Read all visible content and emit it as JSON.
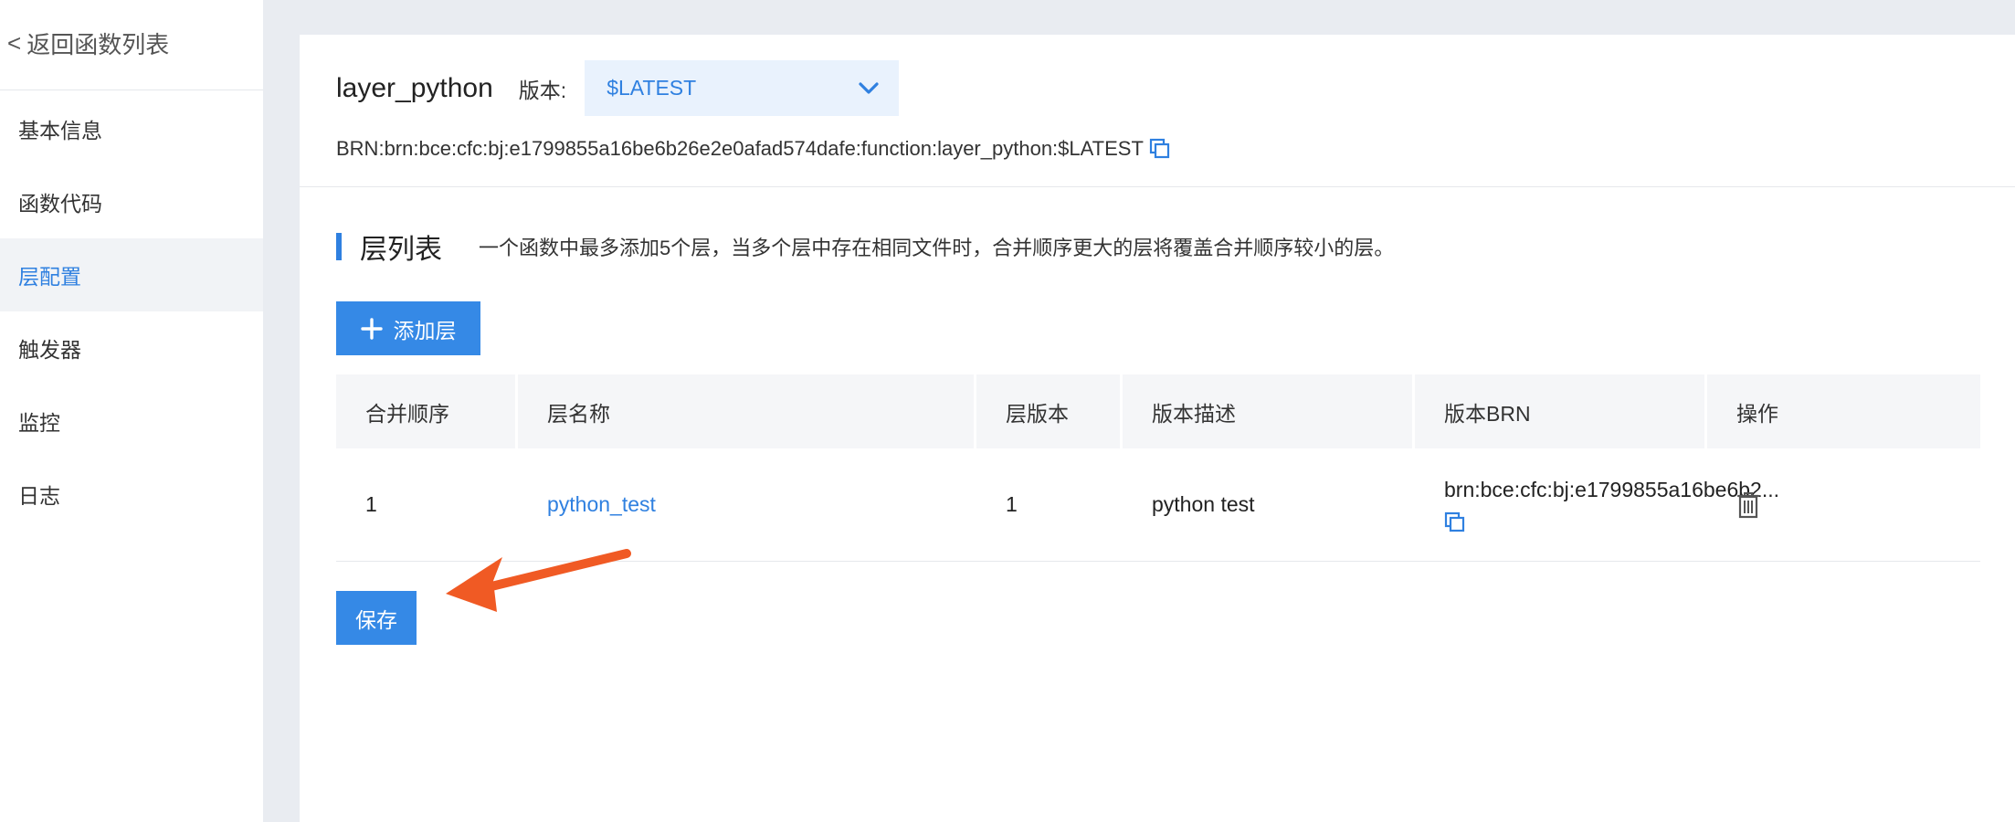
{
  "sidebar": {
    "back_label": "返回函数列表",
    "items": [
      {
        "label": "基本信息"
      },
      {
        "label": "函数代码"
      },
      {
        "label": "层配置"
      },
      {
        "label": "触发器"
      },
      {
        "label": "监控"
      },
      {
        "label": "日志"
      }
    ],
    "active_index": 2
  },
  "header": {
    "function_name": "layer_python",
    "version_label": "版本:",
    "version_value": "$LATEST",
    "brn_label": "BRN:",
    "brn_value": "brn:bce:cfc:bj:e1799855a16be6b26e2e0afad574dafe:function:layer_python:$LATEST"
  },
  "section": {
    "title": "层列表",
    "description": "一个函数中最多添加5个层，当多个层中存在相同文件时，合并顺序更大的层将覆盖合并顺序较小的层。"
  },
  "add_button": {
    "label": "添加层"
  },
  "table": {
    "columns": [
      "合并顺序",
      "层名称",
      "层版本",
      "版本描述",
      "版本BRN",
      "操作"
    ],
    "rows": [
      {
        "order": "1",
        "name": "python_test",
        "version": "1",
        "description": "python test",
        "brn": "brn:bce:cfc:bj:e1799855a16be6b2..."
      }
    ]
  },
  "save_button": {
    "label": "保存"
  },
  "colors": {
    "accent": "#2f80e0",
    "button": "#3589e6",
    "annotation_arrow": "#f05a24"
  },
  "icons": [
    "copy-icon",
    "chevron-down-icon",
    "plus-icon",
    "trash-icon",
    "arrow-annotation"
  ]
}
